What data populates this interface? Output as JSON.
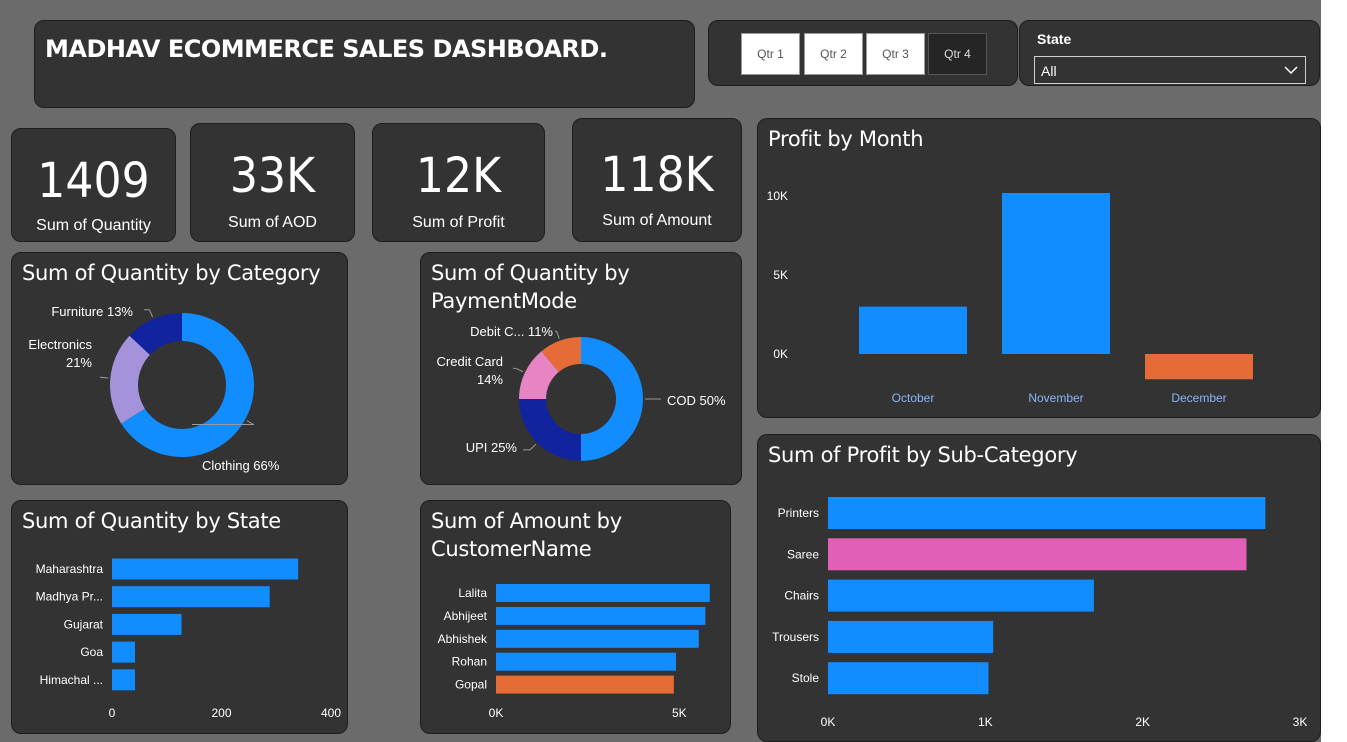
{
  "dashboard": {
    "title": "MADHAV ECOMMERCE SALES DASHBOARD."
  },
  "quarter_slicer": {
    "buttons": [
      {
        "label": "Qtr 1",
        "selected": false
      },
      {
        "label": "Qtr 2",
        "selected": false
      },
      {
        "label": "Qtr 3",
        "selected": false
      },
      {
        "label": "Qtr 4",
        "selected": true
      }
    ]
  },
  "state_slicer": {
    "label": "State",
    "value": "All",
    "icon": "chevron-down-icon"
  },
  "kpis": [
    {
      "value": "1409",
      "label": "Sum of Quantity"
    },
    {
      "value": "33K",
      "label": "Sum of AOD"
    },
    {
      "value": "12K",
      "label": "Sum of Profit"
    },
    {
      "value": "118K",
      "label": "Sum of Amount"
    }
  ],
  "colors": {
    "page_bg": "#6b6b6b",
    "card_bg": "#333333",
    "blue": "#118dff",
    "navy": "#12239e",
    "lavender": "#a493da",
    "orange": "#e66c37",
    "pink": "#e15fb6",
    "pink_light": "#e884c4",
    "month_label": "#8ab4f8"
  },
  "chart_data": [
    {
      "id": "quantity_by_category",
      "type": "pie",
      "title": "Sum of Quantity by Category",
      "slices": [
        {
          "label": "Clothing",
          "value": 66,
          "color": "#118dff"
        },
        {
          "label": "Electronics",
          "value": 21,
          "color": "#a493da"
        },
        {
          "label": "Furniture",
          "value": 13,
          "color": "#12239e"
        }
      ]
    },
    {
      "id": "quantity_by_paymentmode",
      "type": "pie",
      "title": "Sum of Quantity by PaymentMode",
      "slices": [
        {
          "label": "COD",
          "value": 50,
          "color": "#118dff"
        },
        {
          "label": "UPI",
          "value": 25,
          "color": "#12239e"
        },
        {
          "label": "Credit Card",
          "value": 14,
          "color": "#e884c4"
        },
        {
          "label": "Debit C...",
          "value": 11,
          "color": "#e66c37"
        }
      ]
    },
    {
      "id": "profit_by_month",
      "type": "bar",
      "title": "Profit by Month",
      "categories": [
        "October",
        "November",
        "December"
      ],
      "values": [
        3000,
        10200,
        -1600
      ],
      "colors": [
        "#118dff",
        "#118dff",
        "#e66c37"
      ],
      "yticks": [
        "0K",
        "5K",
        "10K"
      ],
      "ylim": [
        -2000,
        10500
      ]
    },
    {
      "id": "profit_by_subcategory",
      "type": "bar",
      "orientation": "horizontal",
      "title": "Sum of Profit by Sub-Category",
      "categories": [
        "Printers",
        "Saree",
        "Chairs",
        "Trousers",
        "Stole"
      ],
      "values": [
        2780,
        2660,
        1690,
        1050,
        1020
      ],
      "colors": [
        "#118dff",
        "#e15fb6",
        "#118dff",
        "#118dff",
        "#118dff"
      ],
      "xticks": [
        "0K",
        "1K",
        "2K",
        "3K"
      ],
      "xlim": [
        0,
        3000
      ]
    },
    {
      "id": "quantity_by_state",
      "type": "bar",
      "orientation": "horizontal",
      "title": "Sum of Quantity by State",
      "categories": [
        "Maharashtra",
        "Madhya Pr...",
        "Gujarat",
        "Goa",
        "Himachal ..."
      ],
      "values": [
        340,
        288,
        127,
        42,
        42
      ],
      "colors": [
        "#118dff",
        "#118dff",
        "#118dff",
        "#118dff",
        "#118dff"
      ],
      "xticks": [
        "0",
        "200",
        "400"
      ],
      "xlim": [
        0,
        400
      ]
    },
    {
      "id": "amount_by_customername",
      "type": "bar",
      "orientation": "horizontal",
      "title": "Sum of Amount by CustomerName",
      "categories": [
        "Lalita",
        "Abhijeet",
        "Abhishek",
        "Rohan",
        "Gopal"
      ],
      "values": [
        5830,
        5710,
        5530,
        4910,
        4850
      ],
      "colors": [
        "#118dff",
        "#118dff",
        "#118dff",
        "#118dff",
        "#e66c37"
      ],
      "xticks": [
        "0K",
        "5K"
      ],
      "xlim": [
        0,
        6000
      ]
    }
  ]
}
